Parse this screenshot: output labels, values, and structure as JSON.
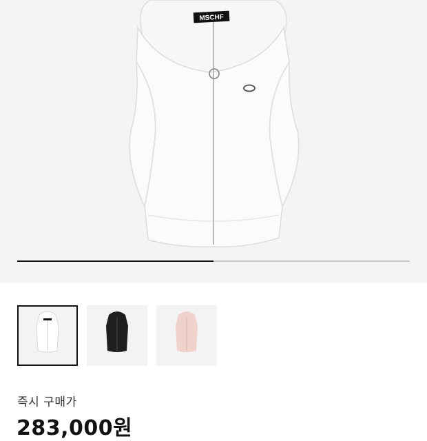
{
  "product": {
    "brand_tag": "MSCHF",
    "image_icon": "hooded-zip-vest-white",
    "gallery_progress": 0.5,
    "gallery_position": 1,
    "gallery_count": 2
  },
  "thumbnails": [
    {
      "color": "white",
      "swatch": "#f2f2f2",
      "selected": true
    },
    {
      "color": "black",
      "swatch": "#1e1e1e",
      "selected": false
    },
    {
      "color": "pink",
      "swatch": "#f0d2cc",
      "selected": false
    }
  ],
  "purchase": {
    "label": "즉시 구매가",
    "price": "283,000원"
  },
  "colors": {
    "hero_bg": "#f4f4f4",
    "progress_active": "#1a1a1a",
    "progress_track": "#c9c9c9",
    "thumb_selected_border": "#111111"
  }
}
